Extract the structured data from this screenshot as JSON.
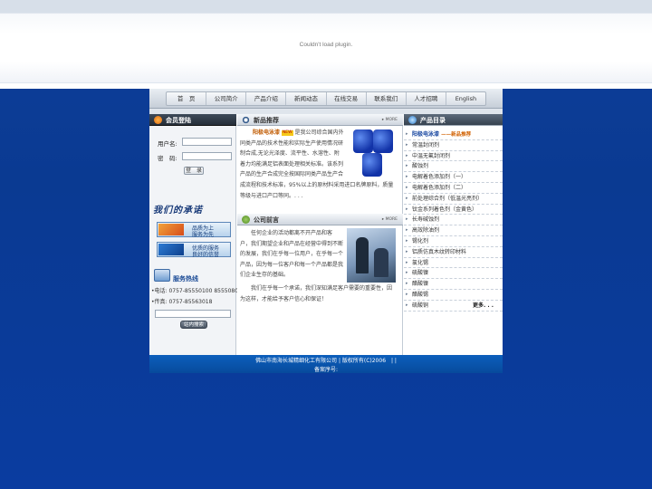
{
  "plugin": {
    "message": "Couldn't load plugin."
  },
  "nav": {
    "items": [
      "首　页",
      "公司简介",
      "产品介绍",
      "新闻动态",
      "在线交易",
      "联系我们",
      "人才招聘",
      "English"
    ]
  },
  "login": {
    "title": "会员登陆",
    "username_label": "用户名:",
    "password_label": "密　码:",
    "submit_label": "登　录"
  },
  "promise": {
    "title": "我们的承诺",
    "box1": {
      "line1": "品质为上",
      "line2": "服务为先"
    },
    "box2": {
      "line1": "优质的服务",
      "line2": "良好的信誉"
    }
  },
  "hotline": {
    "title": "服务热线",
    "phone": "•电话: 0757-85550100 85550800",
    "fax": "•传真: 0757-85563018",
    "search_button": "站内搜索"
  },
  "new_products": {
    "title": "新品推荐",
    "more": "MORE",
    "product_name": "阳极电泳漆",
    "badge": "NEW",
    "lines": [
      "是我公司综合国内外",
      "同类产品的技术性能和实际生产使用情况研",
      "制合成,无论光泽度、流平性、水溶性、附",
      "着力均能满足铝表面处理相关标准。该系列",
      "产品的生产合成完全按国际同类产品生产合",
      "成流程和技术标准，95%以上的原材料采用进口名牌原料，质量",
      "等级与进口产口等同。. . ."
    ]
  },
  "company_news": {
    "title": "公司前言",
    "more": "MORE",
    "lines": [
      "　　任何企业的活动都离不开产品和客",
      "户，我们期望企业和产品在经营中得到不断",
      "的发展，我们在乎每一位用户，在乎每一个",
      "产品，因为每一位客户和每一个产品都是我",
      "们企业生存的基础。",
      "　　我们在乎每一个承诺，我们深知满足客户需要的重要性，因",
      "为这样，才能给予客户信心和保证！"
    ]
  },
  "catalog": {
    "title": "产品目录",
    "first_item": "阳极电泳漆",
    "first_badge": "——新品推荐",
    "items": [
      "常温封闭剂",
      "中温无氟封闭剂",
      "酸蚀剂",
      "电解着色添加剂（一）",
      "电解着色添加剂（二）",
      "前处理综合剂（低温光亮剂）",
      "钛金系列着色剂（金黄色）",
      "长寿碱蚀剂",
      "高效除油剂",
      "锡化剂",
      "铝质仿真木纹转印材料",
      "氯化锡",
      "硫酸镍",
      "醋酸镍",
      "醋酸锡",
      "硫酸铜"
    ],
    "more_link": "更多. . ."
  },
  "footer": {
    "line1": "佛山市南海长城精细化工有限公司 | 版权所有(C)2006　| |",
    "line2": "备案序号:"
  },
  "colors": {
    "page_blue": "#0a3a92",
    "footer_blue": "#0c5fbc",
    "accent_orange": "#c05a00",
    "link_blue": "#1746a0"
  }
}
